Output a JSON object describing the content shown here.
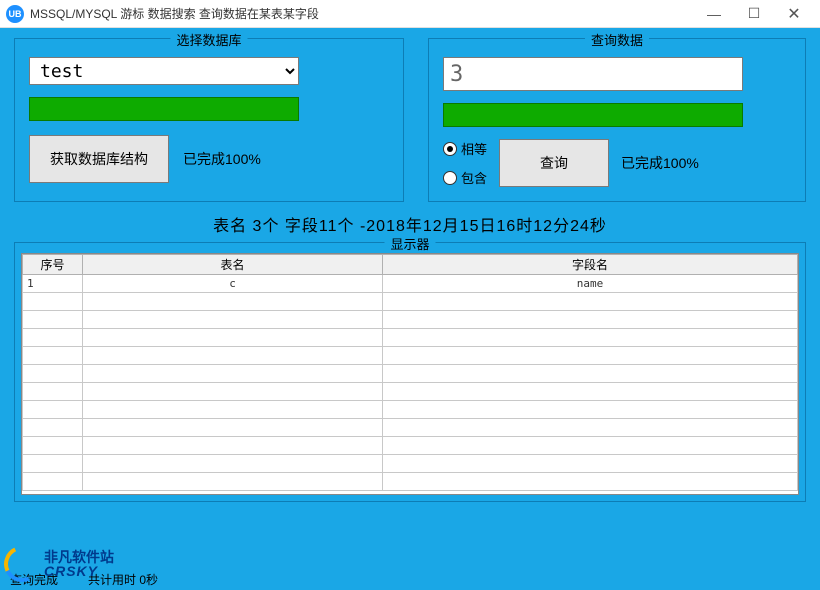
{
  "titlebar": {
    "icon_text": "UB",
    "title": "MSSQL/MYSQL 游标 数据搜索 查询数据在某表某字段",
    "minimize": "—",
    "maximize": "☐",
    "close": "✕"
  },
  "db_panel": {
    "legend": "选择数据库",
    "selected": "test",
    "button": "获取数据库结构",
    "status": "已完成100%"
  },
  "query_panel": {
    "legend": "查询数据",
    "input_value": "3",
    "radios": {
      "equal": "相等",
      "contain": "包含"
    },
    "button": "查询",
    "status": "已完成100%"
  },
  "summary": "表名 3个   字段11个  -2018年12月15日16时12分24秒",
  "grid": {
    "legend": "显示器",
    "headers": {
      "seq": "序号",
      "table": "表名",
      "field": "字段名"
    },
    "rows": [
      {
        "seq": "1",
        "table": "c",
        "field": "name"
      }
    ]
  },
  "statusbar": {
    "left": "查询完成",
    "right": "共计用时 0秒"
  },
  "watermark": {
    "cn": "非凡软件站",
    "en": "CRSKY"
  }
}
